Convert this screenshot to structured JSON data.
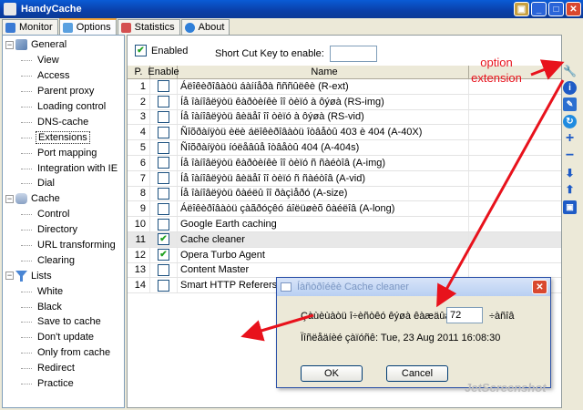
{
  "window": {
    "title": "HandyCache"
  },
  "tabs": [
    {
      "label": "Monitor",
      "icon": "monitor-icon",
      "color": "#3b7bd4"
    },
    {
      "label": "Options",
      "icon": "options-icon",
      "color": "#5aa0e0"
    },
    {
      "label": "Statistics",
      "icon": "statistics-icon",
      "color": "#d45050"
    },
    {
      "label": "About",
      "icon": "about-icon",
      "color": "#2f7fd8"
    }
  ],
  "tree": {
    "groups": [
      {
        "label": "General",
        "icon": "general-icon",
        "children": [
          "View",
          "Access",
          "Parent proxy",
          "Loading control",
          "DNS-cache",
          "Extensions",
          "Port mapping",
          "Integration with IE",
          "Dial"
        ]
      },
      {
        "label": "Cache",
        "icon": "cache-icon",
        "children": [
          "Control",
          "Directory",
          "URL transforming",
          "Clearing"
        ]
      },
      {
        "label": "Lists",
        "icon": "lists-icon",
        "children": [
          "White",
          "Black",
          "Save to cache",
          "Don't update",
          "Only from cache",
          "Redirect",
          "Practice"
        ]
      }
    ],
    "selected": "Extensions"
  },
  "panel": {
    "enabled_label": "Enabled",
    "enabled_checked": true,
    "shortcut_label": "Short Cut Key to enable:",
    "shortcut_value": ""
  },
  "grid": {
    "columns": [
      "P.",
      "Enable",
      "Name"
    ],
    "rows": [
      {
        "p": "1",
        "enabled": false,
        "name": "Áëîêèðîâàòü áàííåðà ñññûëêè (R-ext)"
      },
      {
        "p": "2",
        "enabled": false,
        "name": "Íå îàíîâëÿòü êàðòèíêè îî òèïó à ôýøà (RS-img)"
      },
      {
        "p": "3",
        "enabled": false,
        "name": "Íå îàíîâëÿòü âèäåî îî òèïó à ôýøà (RS-vid)"
      },
      {
        "p": "4",
        "enabled": false,
        "name": "Ñîõðàíÿòü èëè áëîêèðîâàòü îòâåòû 403 è 404 (A-40X)"
      },
      {
        "p": "5",
        "enabled": false,
        "name": "Ñîõðàíÿòü íóëåâûå îòâåòû 404 (A-404s)"
      },
      {
        "p": "6",
        "enabled": false,
        "name": "Íå îàíîâëÿòü êàðòèíêè îî òèïó ñ ñàéòîâ (A-img)"
      },
      {
        "p": "7",
        "enabled": false,
        "name": "Íå îàíîâëÿòü âèäåî îî òèïó ñ ñàéòîâ (A-vid)"
      },
      {
        "p": "8",
        "enabled": false,
        "name": "Íå îàíîâëÿòü ôàéëû îî ðàçìåðó (A-size)"
      },
      {
        "p": "9",
        "enabled": false,
        "name": "Áëîêèðîâàòü çàãðóçêó áîëüøèõ ôàéëîâ (A-long)"
      },
      {
        "p": "10",
        "enabled": false,
        "name": "Google Earth caching"
      },
      {
        "p": "11",
        "enabled": true,
        "name": "Cache cleaner",
        "highlight": true
      },
      {
        "p": "12",
        "enabled": true,
        "name": "Opera Turbo Agent"
      },
      {
        "p": "13",
        "enabled": false,
        "name": "Content Master"
      },
      {
        "p": "14",
        "enabled": false,
        "name": "Smart HTTP Referers"
      }
    ]
  },
  "toolbar_right": [
    {
      "icon": "wrench-icon",
      "color": "#ffffff"
    },
    {
      "icon": "info-icon",
      "color": "#1e5bc6"
    },
    {
      "icon": "edit-icon",
      "color": "#2b6fd0"
    },
    {
      "icon": "refresh-icon",
      "color": "#1f8be0"
    },
    {
      "icon": "add-icon",
      "color": "#1e5bc6"
    },
    {
      "icon": "remove-icon",
      "color": "#1e5bc6"
    },
    {
      "icon": "move-down-icon",
      "color": "#1e5bc6"
    },
    {
      "icon": "move-up-icon",
      "color": "#1e5bc6"
    },
    {
      "icon": "save-icon",
      "color": "#1e5bc6"
    }
  ],
  "dialog": {
    "title": "Íàñòðîéêè Cache cleaner",
    "field_label": "Çàùèùàòü î÷èñòêó êýøà êàæäûå",
    "field_value": "72",
    "unit": "÷àñîâ",
    "last_run": "Ïîñëåäíèé çàïóñê: Tue, 23 Aug 2011 16:08:30",
    "ok_label": "OK",
    "cancel_label": "Cancel"
  },
  "annotation": {
    "text": "option extension",
    "color": "#e8121c"
  },
  "watermark": "JetScreenshot"
}
